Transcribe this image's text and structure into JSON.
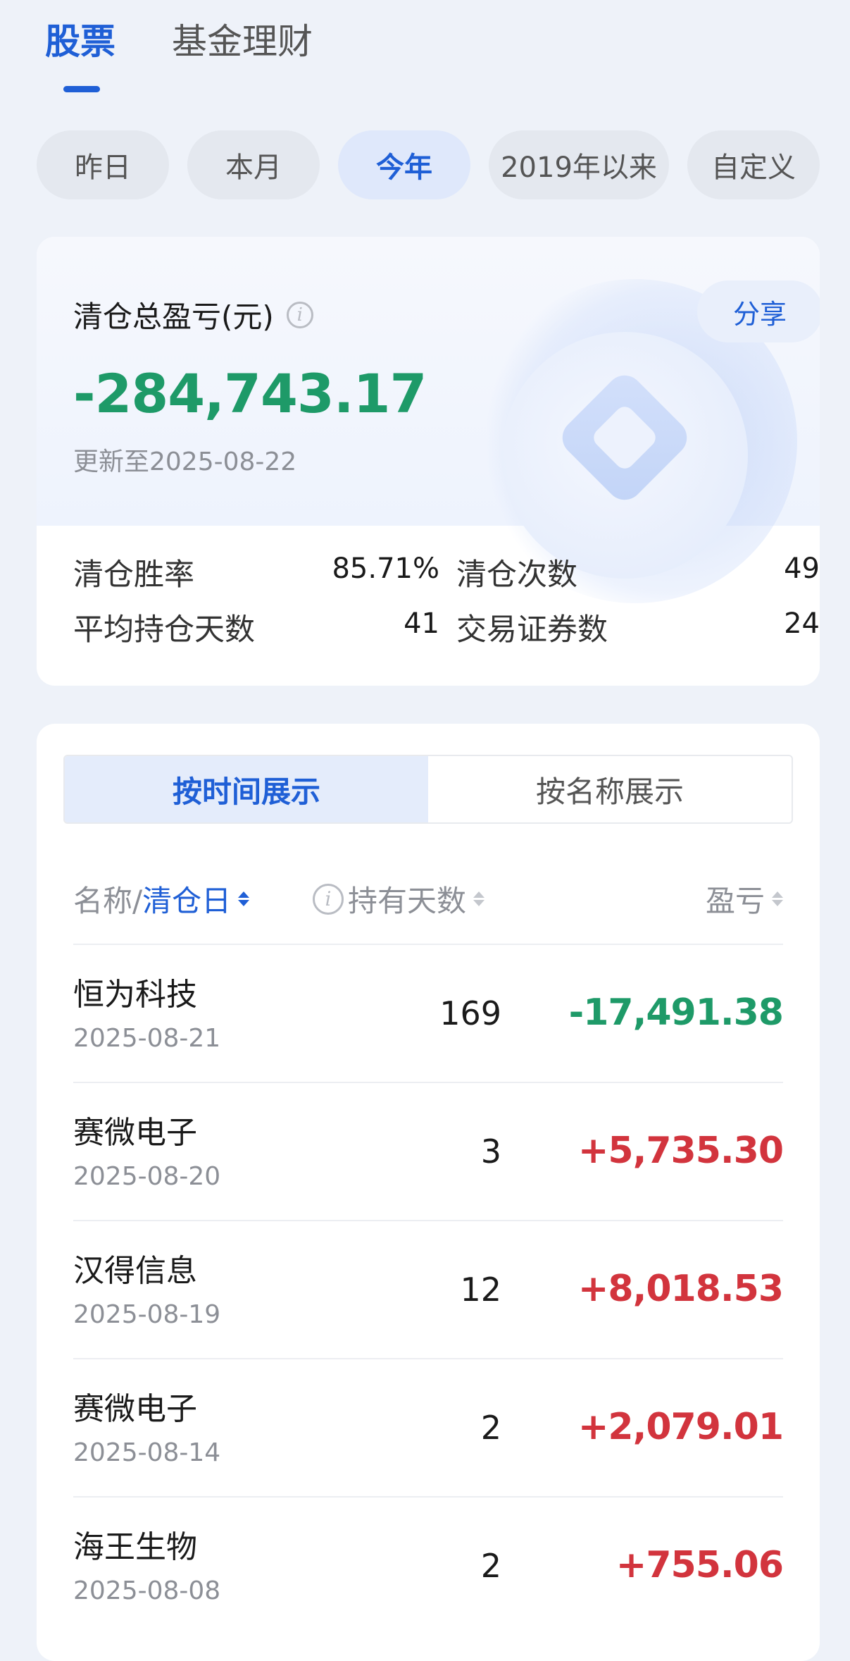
{
  "top_tabs": [
    {
      "label": "股票",
      "active": true
    },
    {
      "label": "基金理财",
      "active": false
    }
  ],
  "periods": [
    {
      "label": "昨日",
      "active": false
    },
    {
      "label": "本月",
      "active": false
    },
    {
      "label": "今年",
      "active": true
    },
    {
      "label": "2019年以来",
      "active": false
    },
    {
      "label": "自定义",
      "active": false
    }
  ],
  "summary": {
    "title": "清仓总盈亏(元)",
    "share_label": "分享",
    "total_value": "-284,743.17",
    "update_text": "更新至2025-08-22",
    "stats": [
      {
        "label": "清仓胜率",
        "value": "85.71%"
      },
      {
        "label": "清仓次数",
        "value": "49"
      },
      {
        "label": "平均持仓天数",
        "value": "41"
      },
      {
        "label": "交易证券数",
        "value": "24"
      }
    ]
  },
  "view_toggle": [
    {
      "label": "按时间展示",
      "active": true
    },
    {
      "label": "按名称展示",
      "active": false
    }
  ],
  "columns": {
    "name_part": "名称/",
    "date_part": "清仓日",
    "days": "持有天数",
    "pnl": "盈亏"
  },
  "rows": [
    {
      "name": "恒为科技",
      "date": "2025-08-21",
      "days": "169",
      "pnl": "-17,491.38",
      "sign": "neg"
    },
    {
      "name": "赛微电子",
      "date": "2025-08-20",
      "days": "3",
      "pnl": "+5,735.30",
      "sign": "pos"
    },
    {
      "name": "汉得信息",
      "date": "2025-08-19",
      "days": "12",
      "pnl": "+8,018.53",
      "sign": "pos"
    },
    {
      "name": "赛微电子",
      "date": "2025-08-14",
      "days": "2",
      "pnl": "+2,079.01",
      "sign": "pos"
    },
    {
      "name": "海王生物",
      "date": "2025-08-08",
      "days": "2",
      "pnl": "+755.06",
      "sign": "pos"
    }
  ],
  "colors": {
    "accent": "#1f5fd6",
    "loss": "#1e9a68",
    "gain": "#d2343d"
  }
}
